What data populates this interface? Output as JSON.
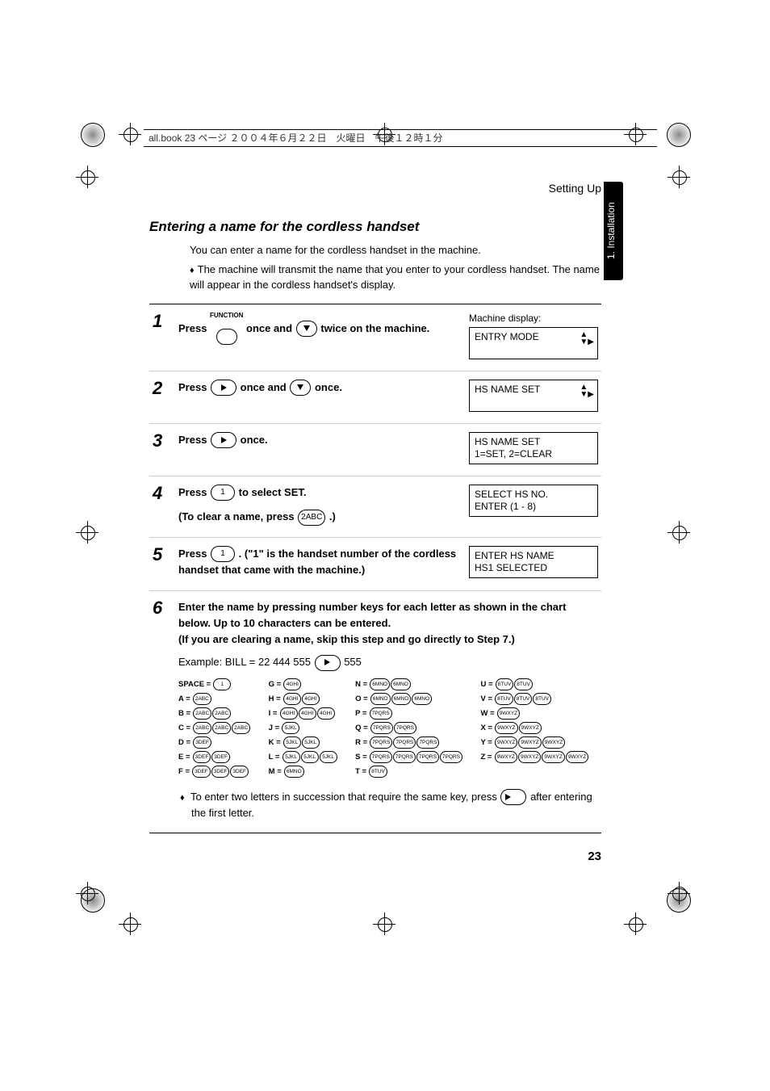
{
  "header_strip": "all.book  23 ページ  ２００４年６月２２日　火曜日　午後１２時１分",
  "running_head": "Setting Up",
  "chapter_tab": "1. Installation",
  "section_title": "Entering a name for the cordless handset",
  "intro_p1": "You can enter a name for the cordless handset in the machine.",
  "intro_p2": "The machine will transmit the name that you enter to your cordless handset. The name will appear in the cordless handset's display.",
  "steps": [
    {
      "num": "1",
      "body_pre": "Press ",
      "body_mid": " once and ",
      "body_post": " twice on the machine.",
      "disp_label": "Machine display:",
      "lcd": "ENTRY MODE",
      "show_arrows": true
    },
    {
      "num": "2",
      "body_pre": "Press ",
      "body_mid": " once and ",
      "body_post": " once.",
      "lcd": "HS NAME SET",
      "show_arrows": true
    },
    {
      "num": "3",
      "body_pre": "Press ",
      "body_post": " once.",
      "lcd": "HS NAME SET\n1=SET, 2=CLEAR"
    },
    {
      "num": "4",
      "body_pre": "Press ",
      "body_post": " to select SET.",
      "sub": "(To clear a name, press ",
      "sub_post": " .)",
      "lcd": "SELECT HS NO.\nENTER (1 - 8)"
    },
    {
      "num": "5",
      "body_pre": "Press ",
      "body_post": " . (\"1\" is the handset number of the cordless handset that came with the machine.)",
      "lcd": "ENTER HS NAME\nHS1 SELECTED"
    },
    {
      "num": "6",
      "body": "Enter the name by pressing number keys for each letter as shown in the chart below. Up to 10 characters can be entered.\n(If you are clearing a name, skip this step and go directly to Step 7.)",
      "example_pre": "Example: BILL = 22  444  555  ",
      "example_post": "  555"
    }
  ],
  "key_labels": {
    "function": "FUNCTION",
    "one": "1",
    "two": "2ABC"
  },
  "chart": {
    "col1": [
      {
        "l": "SPACE =",
        "k": [
          "1"
        ]
      },
      {
        "l": "A =",
        "k": [
          "2ABC"
        ]
      },
      {
        "l": "B =",
        "k": [
          "2ABC",
          "2ABC"
        ]
      },
      {
        "l": "C =",
        "k": [
          "2ABC",
          "2ABC",
          "2ABC"
        ]
      },
      {
        "l": "D =",
        "k": [
          "3DEF"
        ]
      },
      {
        "l": "E =",
        "k": [
          "3DEF",
          "3DEF"
        ]
      },
      {
        "l": "F =",
        "k": [
          "3DEF",
          "3DEF",
          "3DEF"
        ]
      }
    ],
    "col2": [
      {
        "l": "G =",
        "k": [
          "4GHI"
        ]
      },
      {
        "l": "H =",
        "k": [
          "4GHI",
          "4GHI"
        ]
      },
      {
        "l": "I =",
        "k": [
          "4GHI",
          "4GHI",
          "4GHI"
        ]
      },
      {
        "l": "J =",
        "k": [
          "5JKL"
        ]
      },
      {
        "l": "K =",
        "k": [
          "5JKL",
          "5JKL"
        ]
      },
      {
        "l": "L =",
        "k": [
          "5JKL",
          "5JKL",
          "5JKL"
        ]
      },
      {
        "l": "M =",
        "k": [
          "6MNO"
        ]
      }
    ],
    "col3": [
      {
        "l": "N =",
        "k": [
          "6MNO",
          "6MNO"
        ]
      },
      {
        "l": "O =",
        "k": [
          "6MNO",
          "6MNO",
          "6MNO"
        ]
      },
      {
        "l": "P =",
        "k": [
          "7PQRS"
        ]
      },
      {
        "l": "Q =",
        "k": [
          "7PQRS",
          "7PQRS"
        ]
      },
      {
        "l": "R =",
        "k": [
          "7PQRS",
          "7PQRS",
          "7PQRS"
        ]
      },
      {
        "l": "S =",
        "k": [
          "7PQRS",
          "7PQRS",
          "7PQRS",
          "7PQRS"
        ]
      },
      {
        "l": "T =",
        "k": [
          "8TUV"
        ]
      }
    ],
    "col4": [
      {
        "l": "U =",
        "k": [
          "8TUV",
          "8TUV"
        ]
      },
      {
        "l": "V =",
        "k": [
          "8TUV",
          "8TUV",
          "8TUV"
        ]
      },
      {
        "l": "W =",
        "k": [
          "9WXYZ"
        ]
      },
      {
        "l": "X =",
        "k": [
          "9WXYZ",
          "9WXYZ"
        ]
      },
      {
        "l": "Y =",
        "k": [
          "9WXYZ",
          "9WXYZ",
          "9WXYZ"
        ]
      },
      {
        "l": "Z =",
        "k": [
          "9WXYZ",
          "9WXYZ",
          "9WXYZ",
          "9WXYZ"
        ]
      }
    ]
  },
  "footnote_pre": "To enter two letters in succession that require the same key, press ",
  "footnote_post": " after entering the first letter.",
  "page_number": "23"
}
